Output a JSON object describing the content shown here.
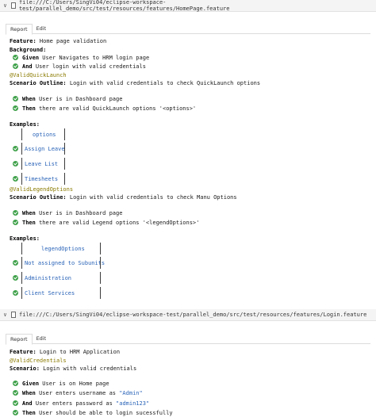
{
  "features": [
    {
      "path": "file:///C:/Users/SingVi04/eclipse-workspace-test/parallel_demo/src/test/resources/features/HomePage.feature",
      "tabs": [
        "Report",
        "Edit"
      ],
      "feature_kw": "Feature:",
      "feature_name": " Home page validation",
      "background_kw": "Background:",
      "background_steps": [
        {
          "kw": "Given",
          "text": " User Navigates to HRM login page"
        },
        {
          "kw": "And",
          "text": " User login with valid credentials"
        }
      ],
      "outlines": [
        {
          "tag": "@ValidQuickLaunch",
          "scenario_kw": "Scenario Outline:",
          "scenario_name": " Login with valid credentials to check QuickLaunch options",
          "steps": [
            {
              "kw": "When",
              "text": " User is in Dashboard page",
              "str": ""
            },
            {
              "kw": "Then",
              "text": " there are valid QuickLaunch options '<options>'",
              "str": ""
            }
          ],
          "examples_kw": "Examples:",
          "table_header": "options",
          "rows": [
            "Assign Leave",
            "Leave List",
            "Timesheets"
          ]
        },
        {
          "tag": "@ValidLegendOptions",
          "scenario_kw": "Scenario Outline:",
          "scenario_name": " Login with valid credentials to check Manu Options",
          "steps": [
            {
              "kw": "When",
              "text": " User is in Dashboard page",
              "str": ""
            },
            {
              "kw": "Then",
              "text": " there are valid Legend options '<legendOptions>'",
              "str": ""
            }
          ],
          "examples_kw": "Examples:",
          "table_header": "legendOptions",
          "rows": [
            "Not assigned to Subunits",
            "Administration",
            "Client Services"
          ]
        }
      ]
    },
    {
      "path": "file:///C:/Users/SingVi04/eclipse-workspace-test/parallel_demo/src/test/resources/features/Login.feature",
      "tabs": [
        "Report",
        "Edit"
      ],
      "feature_kw": "Feature:",
      "feature_name": " Login to HRM Application",
      "tag": "@ValidCredentials",
      "scenario_kw": "Scenario:",
      "scenario_name": " Login with valid credentials",
      "steps": [
        {
          "kw": "Given",
          "text": " User is on Home page",
          "str": ""
        },
        {
          "kw": "When",
          "text": " User enters username as ",
          "str": "\"Admin\""
        },
        {
          "kw": "And",
          "text": " User enters password as ",
          "str": "\"admin123\""
        },
        {
          "kw": "Then",
          "text": " User should be able to login sucessfully",
          "str": ""
        }
      ]
    }
  ],
  "colors": {
    "pass": "#3fa14a",
    "keyword": "#000000",
    "tag": "#8a7a00",
    "string": "#2a64b8"
  },
  "icons": {
    "collapse": "chevron-down-icon",
    "file": "file-icon",
    "status": "passed-check-icon"
  }
}
